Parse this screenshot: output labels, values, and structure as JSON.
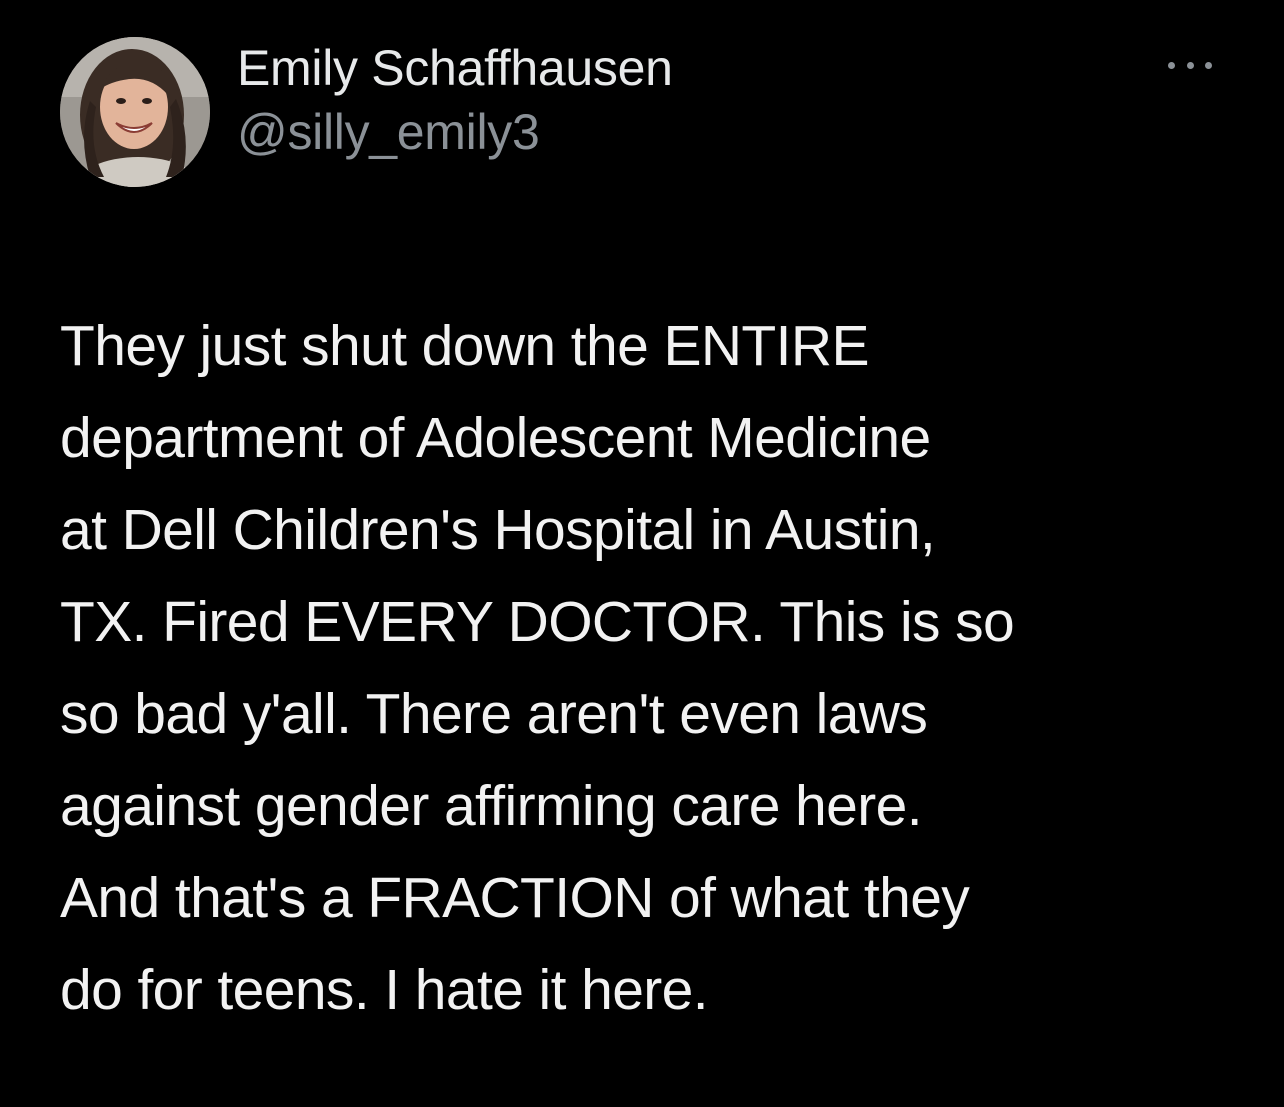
{
  "author": {
    "display_name": "Emily Schaffhausen",
    "handle": "@silly_emily3",
    "avatar_icon": "profile-photo"
  },
  "more_icon": "ellipsis-icon",
  "tweet": {
    "lines": [
      "They just shut down the ENTIRE",
      "department of Adolescent Medicine",
      "at Dell Children's Hospital in Austin,",
      "TX. Fired EVERY DOCTOR. This is so",
      "so bad y'all. There aren't even laws",
      "against gender affirming care here.",
      "And that's a FRACTION of what they",
      "do for teens. I hate it here."
    ]
  },
  "colors": {
    "background": "#000000",
    "primary_text": "#e7e9ea",
    "secondary_text": "#8b9197"
  }
}
